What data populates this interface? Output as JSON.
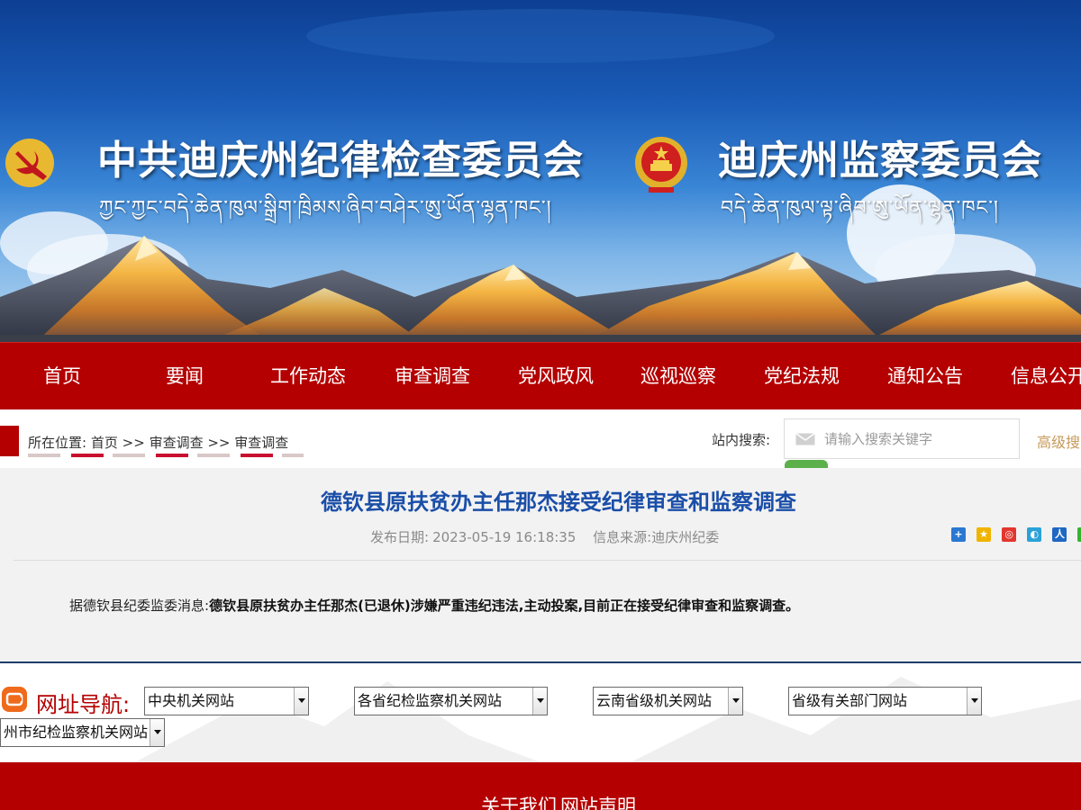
{
  "header": {
    "title_left_cn": "中共迪庆州纪律检查委员会",
    "title_left_tb": "ཀྱང་ཀྱང་བདེ་ཆེན་ཁུལ་སྒྲིག་ཁྲིམས་ཞིབ་བཤེར་ཨུ་ཡོན་ལྷན་ཁང་།",
    "title_right_cn": "迪庆州监察委员会",
    "title_right_tb": "བདེ་ཆེན་ཁུལ་ལྟ་ཞིབ་ཨུ་ཡོན་ལྷན་ཁང་།"
  },
  "nav": {
    "items": [
      "首页",
      "要闻",
      "工作动态",
      "审查调查",
      "党风政风",
      "巡视巡察",
      "党纪法规",
      "通知公告",
      "信息公开"
    ]
  },
  "location": {
    "label": "所在位置:",
    "crumbs": [
      "首页",
      "审查调查",
      "审查调查"
    ],
    "separator": ">>"
  },
  "search": {
    "label": "站内搜索:",
    "placeholder": "请输入搜索关键字",
    "advanced": "高级搜索"
  },
  "article": {
    "title": "德钦县原扶贫办主任那杰接受纪律审查和监察调查",
    "date_label": "发布日期:",
    "date": "2023-05-19 16:18:35",
    "source_label": "信息来源:",
    "source": "迪庆州纪委",
    "body_prefix": "据德钦县纪委监委消息:",
    "body_bold": "德钦县原扶贫办主任那杰(已退休)涉嫌严重违纪违法,主动投案,目前正在接受纪律审查和监察调查。"
  },
  "share_icons": [
    "more-share-icon",
    "qzone-icon",
    "weibo-icon",
    "tencent-weibo-icon",
    "renren-icon",
    "wechat-icon"
  ],
  "links": {
    "label": "网址导航:",
    "selects": [
      "中央机关网站",
      "各省纪检监察机关网站",
      "云南省级机关网站",
      "省级有关部门网站",
      "州市纪检监察机关网站"
    ]
  },
  "footer": {
    "links": [
      "关于我们",
      "网站声明"
    ]
  },
  "colors": {
    "brand_red": "#b40000",
    "title_blue": "#1a4ea8",
    "advanced_search": "#c79a5a",
    "search_green": "#5bb04a"
  }
}
